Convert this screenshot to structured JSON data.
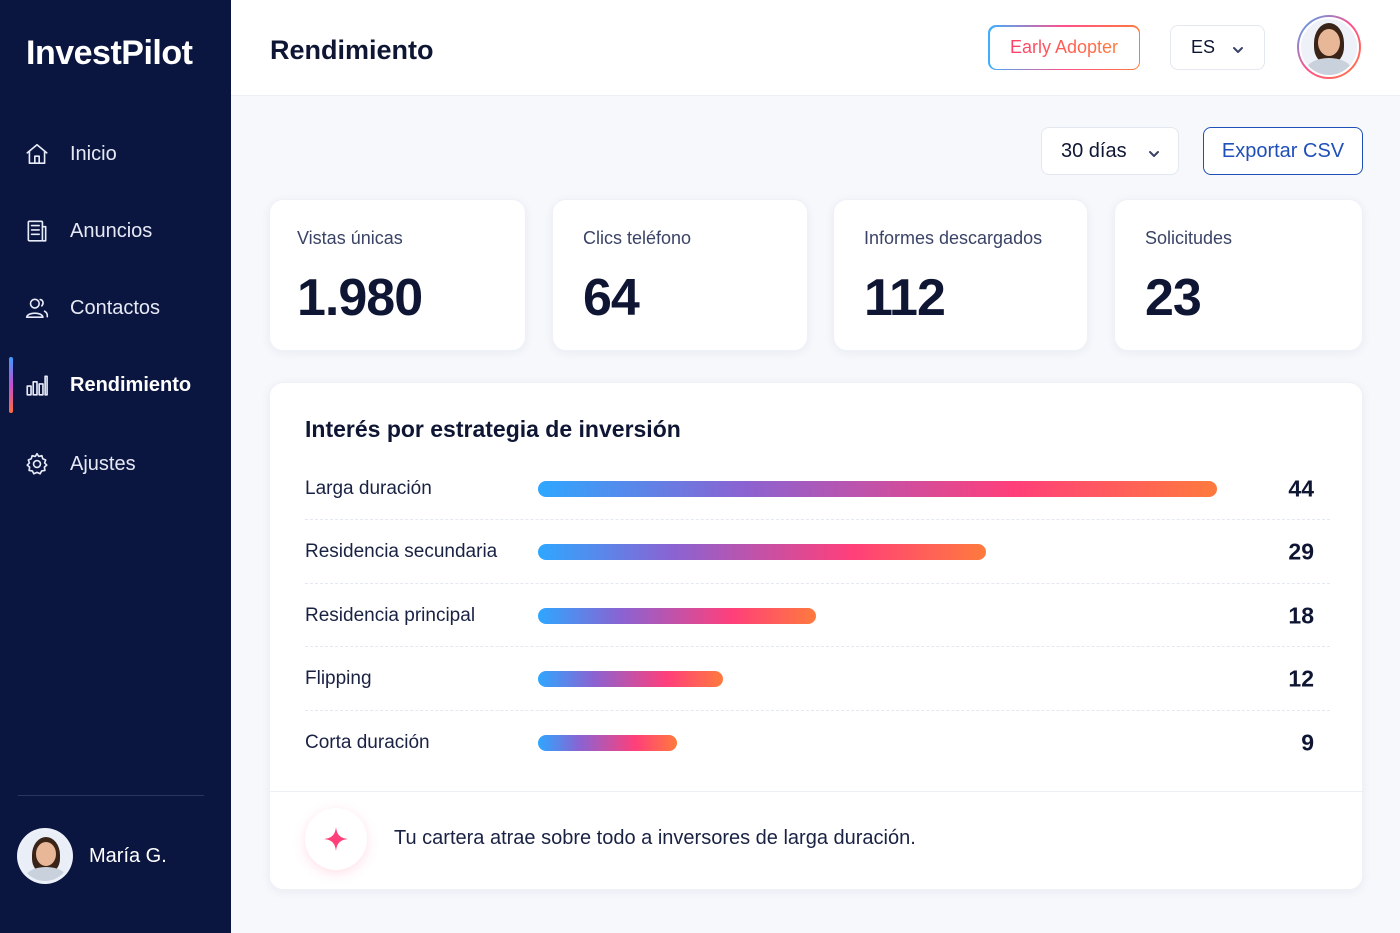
{
  "app": {
    "name": "InvestPilot"
  },
  "sidebar": {
    "items": [
      {
        "label": "Inicio",
        "icon": "home-icon",
        "active": false
      },
      {
        "label": "Anuncios",
        "icon": "document-icon",
        "active": false
      },
      {
        "label": "Contactos",
        "icon": "users-icon",
        "active": false
      },
      {
        "label": "Rendimiento",
        "icon": "bar-chart-icon",
        "active": true
      },
      {
        "label": "Ajustes",
        "icon": "gear-icon",
        "active": false
      }
    ],
    "user": {
      "name": "María G."
    }
  },
  "header": {
    "title": "Rendimiento",
    "badge": "Early Adopter",
    "language": "ES"
  },
  "toolbar": {
    "period": "30 días",
    "export_label": "Exportar CSV"
  },
  "stats": [
    {
      "label": "Vistas únicas",
      "value": "1.980"
    },
    {
      "label": "Clics teléfono",
      "value": "64"
    },
    {
      "label": "Informes descargados",
      "value": "112"
    },
    {
      "label": "Solicitudes",
      "value": "23"
    }
  ],
  "chart_data": {
    "type": "bar",
    "title": "Interés por estrategia de inversión",
    "categories": [
      "Larga duración",
      "Residencia secundaria",
      "Residencia principal",
      "Flipping",
      "Corta duración"
    ],
    "values": [
      44,
      29,
      18,
      12,
      9
    ],
    "value_labels": [
      "44",
      "29",
      "18",
      "12",
      "9"
    ],
    "orientation": "horizontal",
    "xlim": [
      0,
      44
    ]
  },
  "insight": {
    "icon": "sparkle-icon",
    "text": "Tu cartera atrae sobre todo a inversores de larga duración."
  },
  "colors": {
    "sidebar_bg": "#0b1640",
    "accent_blue": "#1f4fb8",
    "gradient_start": "#2ea7ff",
    "gradient_end": "#ff7a3d"
  }
}
